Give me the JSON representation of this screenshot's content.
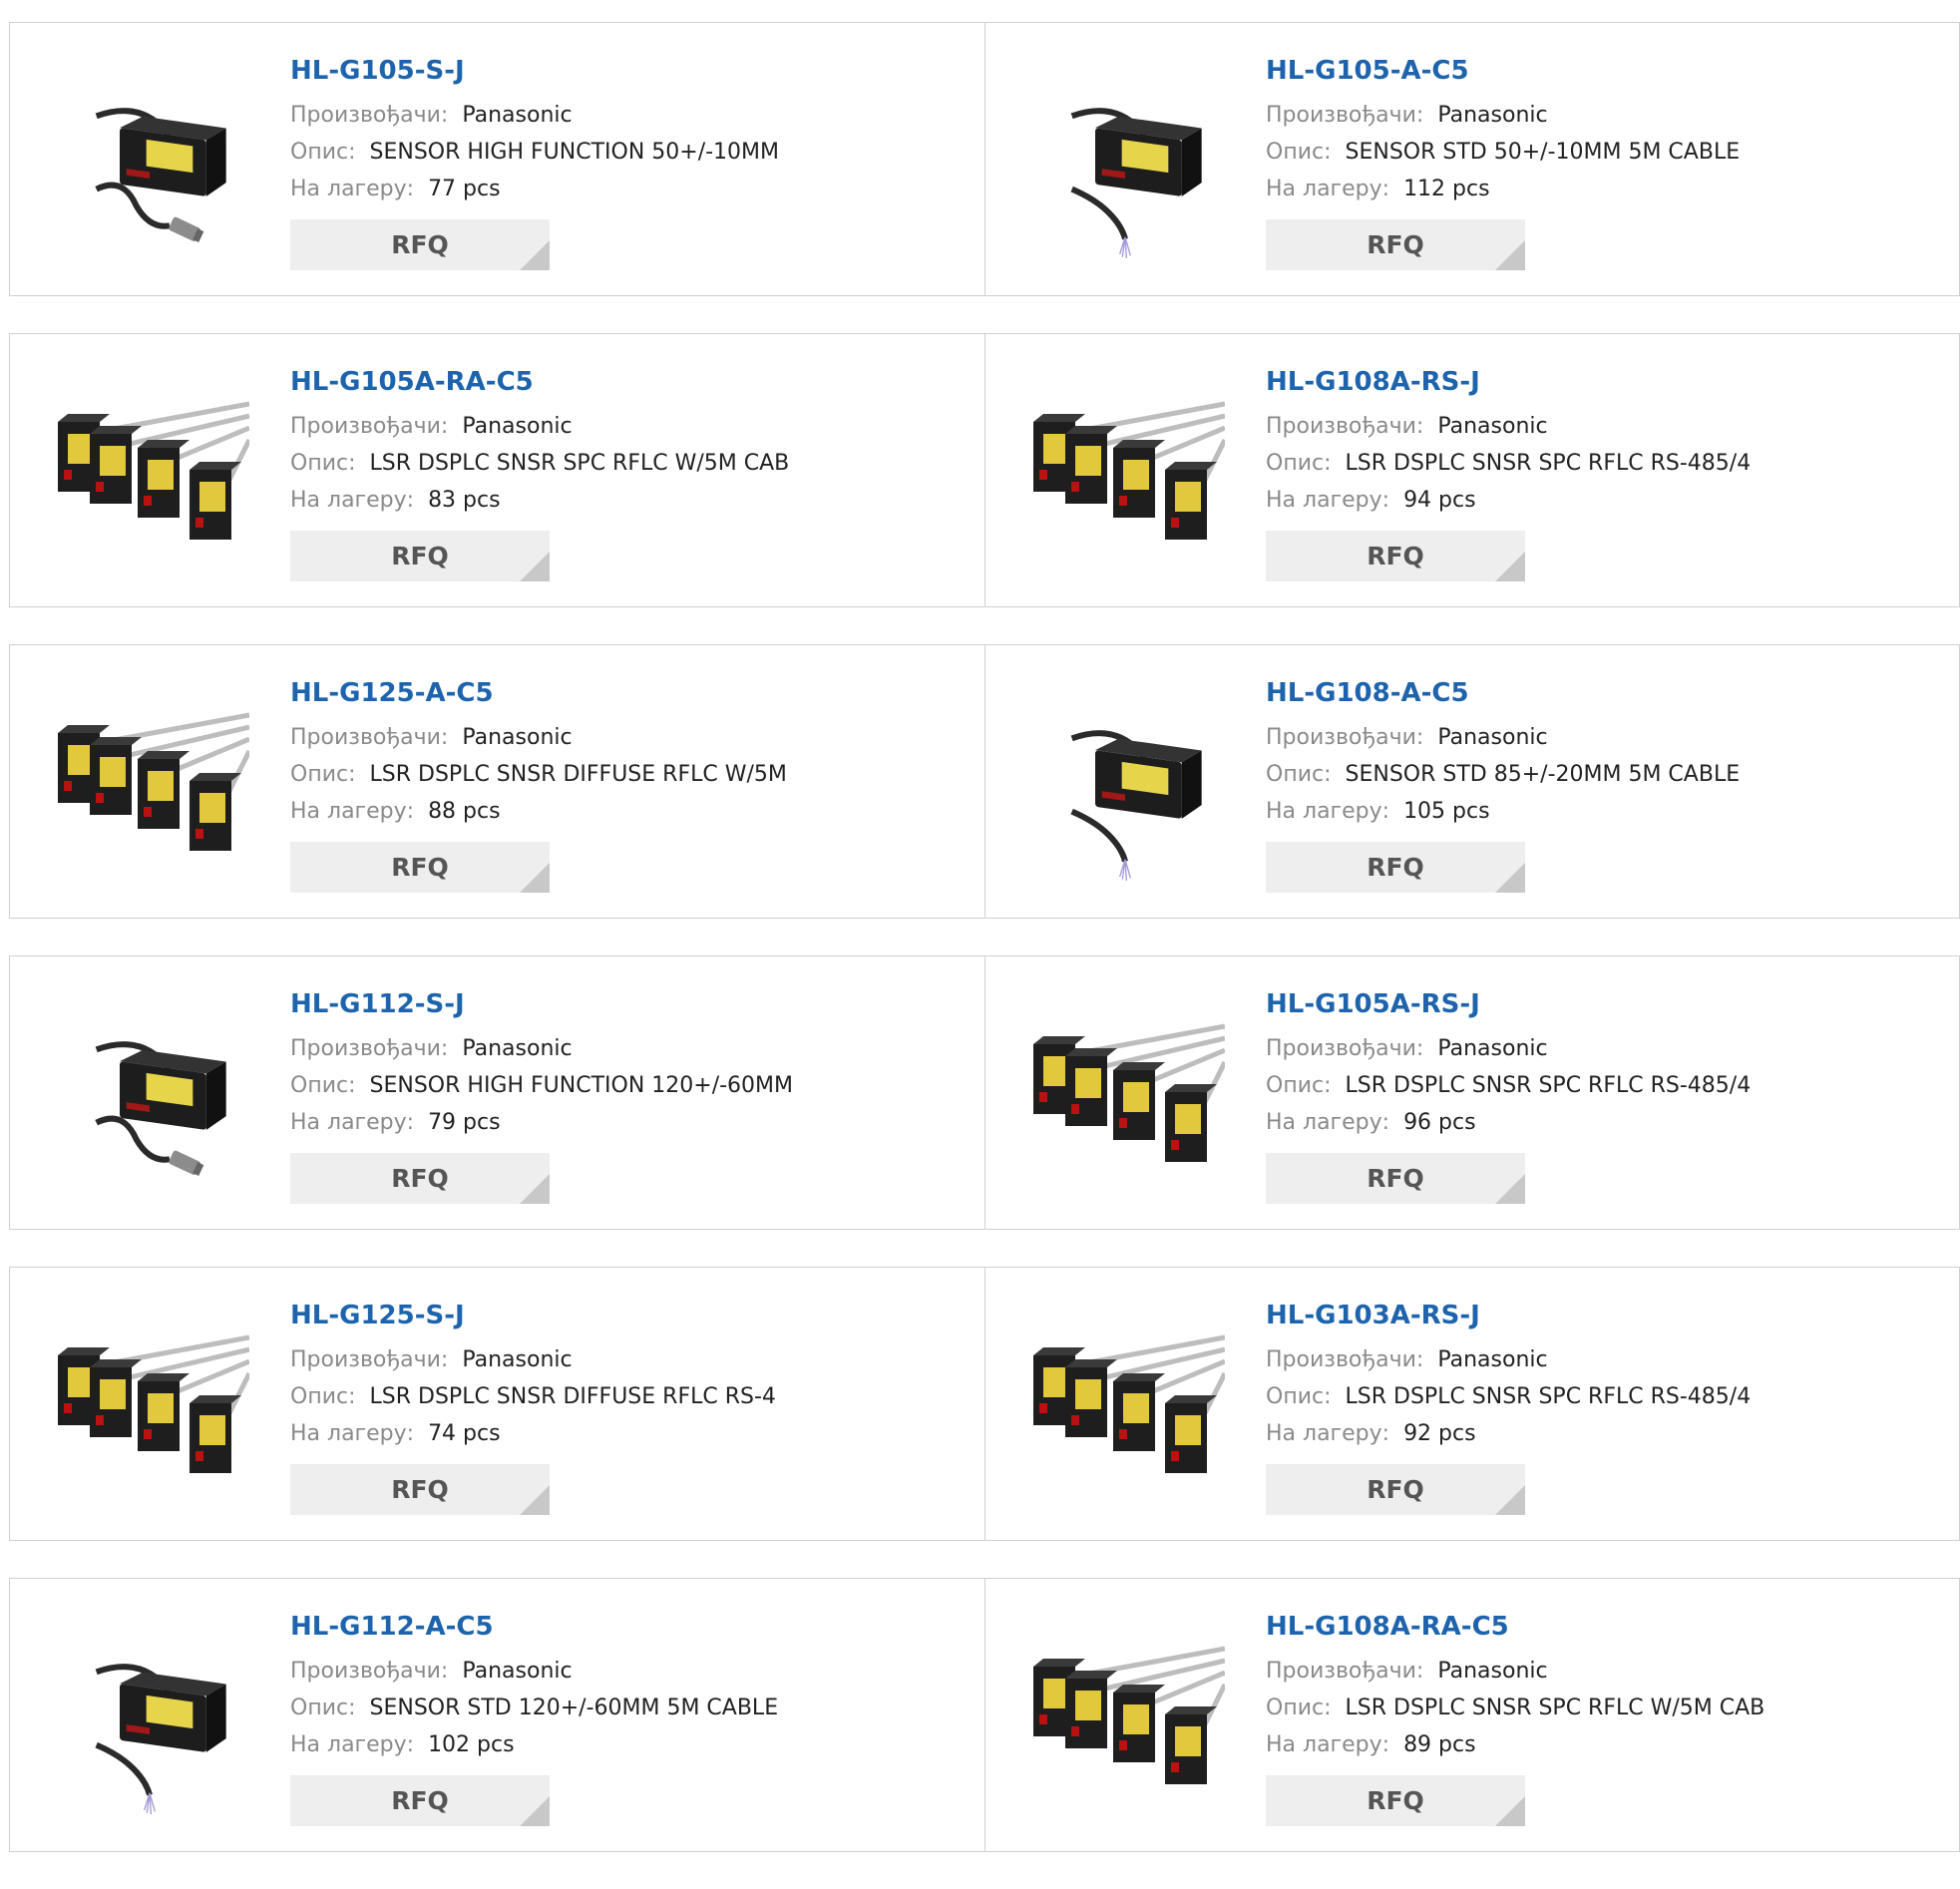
{
  "labels": {
    "manufacturer": "Произвођачи:",
    "description": "Опис:",
    "stock": "На лагеру:",
    "rfq": "RFQ"
  },
  "products": [
    {
      "part": "HL-G105-S-J",
      "manufacturer": "Panasonic",
      "description": "SENSOR HIGH FUNCTION 50+/-10MM",
      "stock": "77 pcs",
      "image": "single-connector"
    },
    {
      "part": "HL-G105-A-C5",
      "manufacturer": "Panasonic",
      "description": "SENSOR STD 50+/-10MM 5M CABLE",
      "stock": "112 pcs",
      "image": "single-cable"
    },
    {
      "part": "HL-G105A-RA-C5",
      "manufacturer": "Panasonic",
      "description": "LSR DSPLC SNSR SPC RFLC W/5M CAB",
      "stock": "83 pcs",
      "image": "group"
    },
    {
      "part": "HL-G108A-RS-J",
      "manufacturer": "Panasonic",
      "description": "LSR DSPLC SNSR SPC RFLC RS-485/4",
      "stock": "94 pcs",
      "image": "group"
    },
    {
      "part": "HL-G125-A-C5",
      "manufacturer": "Panasonic",
      "description": "LSR DSPLC SNSR DIFFUSE RFLC W/5M",
      "stock": "88 pcs",
      "image": "group"
    },
    {
      "part": "HL-G108-A-C5",
      "manufacturer": "Panasonic",
      "description": "SENSOR STD 85+/-20MM 5M CABLE",
      "stock": "105 pcs",
      "image": "single-cable"
    },
    {
      "part": "HL-G112-S-J",
      "manufacturer": "Panasonic",
      "description": "SENSOR HIGH FUNCTION 120+/-60MM",
      "stock": "79 pcs",
      "image": "single-connector"
    },
    {
      "part": "HL-G105A-RS-J",
      "manufacturer": "Panasonic",
      "description": "LSR DSPLC SNSR SPC RFLC RS-485/4",
      "stock": "96 pcs",
      "image": "group"
    },
    {
      "part": "HL-G125-S-J",
      "manufacturer": "Panasonic",
      "description": "LSR DSPLC SNSR DIFFUSE RFLC RS-4",
      "stock": "74 pcs",
      "image": "group"
    },
    {
      "part": "HL-G103A-RS-J",
      "manufacturer": "Panasonic",
      "description": "LSR DSPLC SNSR SPC RFLC RS-485/4",
      "stock": "92 pcs",
      "image": "group"
    },
    {
      "part": "HL-G112-A-C5",
      "manufacturer": "Panasonic",
      "description": "SENSOR STD 120+/-60MM 5M CABLE",
      "stock": "102 pcs",
      "image": "single-cable"
    },
    {
      "part": "HL-G108A-RA-C5",
      "manufacturer": "Panasonic",
      "description": "LSR DSPLC SNSR SPC RFLC W/5M CAB",
      "stock": "89 pcs",
      "image": "group"
    }
  ]
}
